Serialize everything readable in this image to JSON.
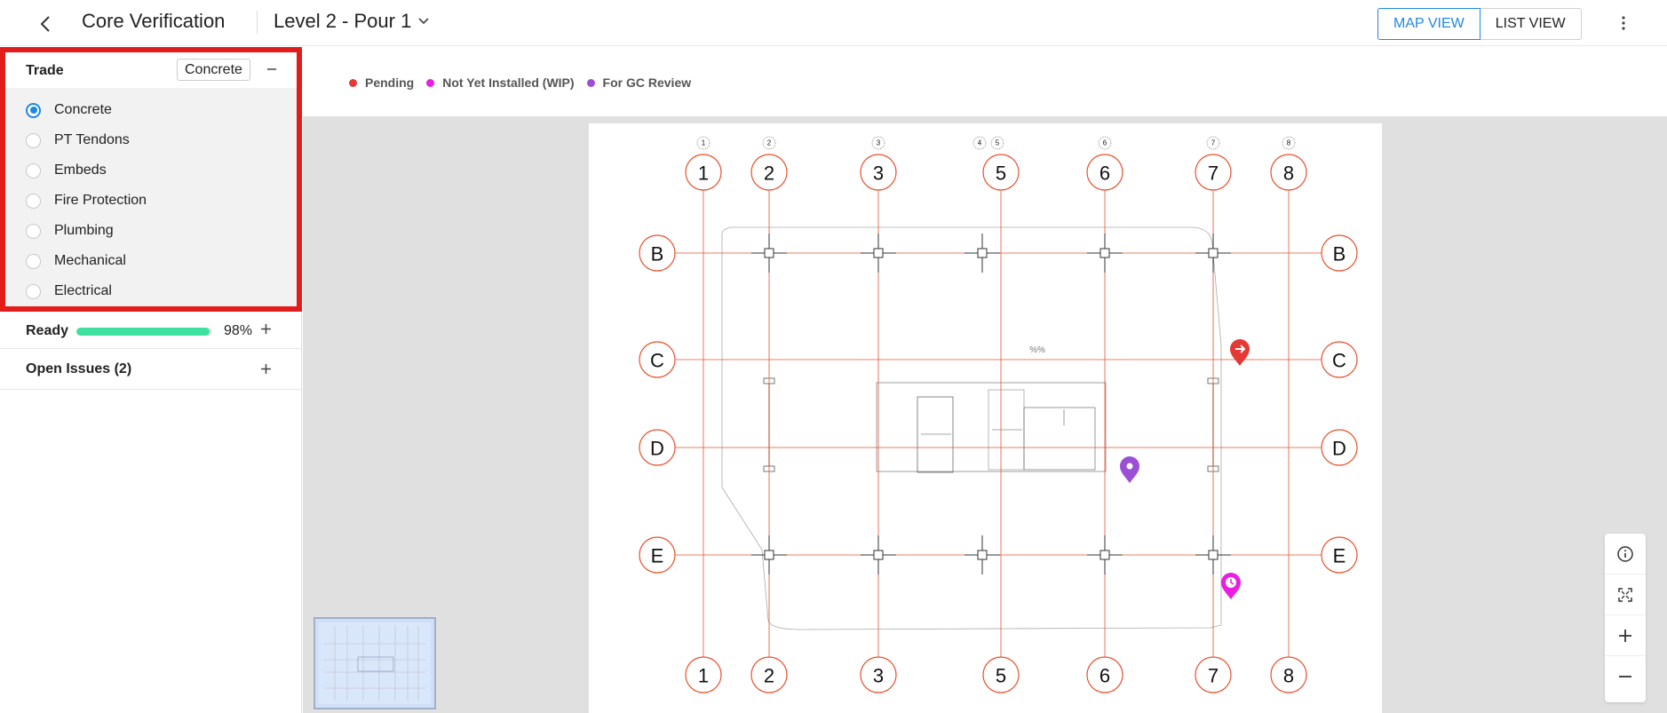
{
  "header": {
    "title": "Core Verification",
    "level": "Level 2 - Pour 1",
    "views": {
      "map": "MAP VIEW",
      "list": "LIST VIEW"
    }
  },
  "trade": {
    "title": "Trade",
    "selected_chip": "Concrete",
    "items": [
      {
        "label": "Concrete",
        "checked": true
      },
      {
        "label": "PT Tendons",
        "checked": false
      },
      {
        "label": "Embeds",
        "checked": false
      },
      {
        "label": "Fire Protection",
        "checked": false
      },
      {
        "label": "Plumbing",
        "checked": false
      },
      {
        "label": "Mechanical",
        "checked": false
      },
      {
        "label": "Electrical",
        "checked": false
      }
    ]
  },
  "ready": {
    "label": "Ready",
    "percent": "98%",
    "fraction": 0.98
  },
  "issues": {
    "label": "Open Issues (2)"
  },
  "legend": [
    {
      "label": "Pending",
      "color": "#e53935"
    },
    {
      "label": "Not Yet Installed (WIP)",
      "color": "#e91ee0"
    },
    {
      "label": "For GC Review",
      "color": "#9b4fd6"
    }
  ],
  "drawing": {
    "grid_columns": [
      "1",
      "2",
      "3",
      "5",
      "6",
      "7",
      "8"
    ],
    "grid_rows": [
      "B",
      "C",
      "D",
      "E"
    ],
    "small_tags": [
      "1",
      "2",
      "3",
      "4",
      "5",
      "6",
      "7",
      "8"
    ],
    "grid_color": "#e8502e",
    "pins": [
      {
        "status": "Pending",
        "color": "#e53935",
        "icon": "arrow-right-icon"
      },
      {
        "status": "For GC Review",
        "color": "#9b4fd6",
        "icon": "location-pin-icon"
      },
      {
        "status": "Not Yet Installed (WIP)",
        "color": "#e91ee0",
        "icon": "clock-icon"
      }
    ]
  },
  "controls": [
    "info-icon",
    "fit-screen-icon",
    "zoom-in-icon",
    "zoom-out-icon"
  ]
}
